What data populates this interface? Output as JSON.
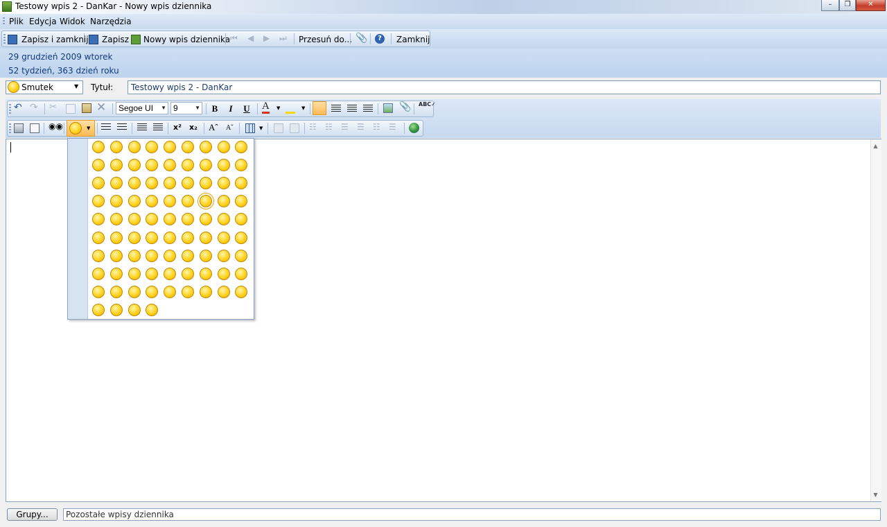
{
  "window": {
    "title": "Testowy wpis 2 - DanKar - Nowy wpis dziennika"
  },
  "menu": {
    "items": [
      "Plik",
      "Edycja",
      "Widok",
      "Narzędzia"
    ]
  },
  "toolbar": {
    "save_close": "Zapisz i zamknij",
    "save": "Zapisz",
    "new_entry": "Nowy wpis dziennika",
    "move_to": "Przesuń do...",
    "close": "Zamknij"
  },
  "header": {
    "date": "29 grudzień 2009 wtorek",
    "week_day": "52 tydzień,  363 dzień roku"
  },
  "entry": {
    "mood": "Smutek",
    "title_label": "Tytuł:",
    "title_value": "Testowy wpis 2 - DanKar"
  },
  "format": {
    "font": "Segoe UI",
    "size": "9",
    "bold": "B",
    "italic": "I",
    "underline": "U"
  },
  "status": {
    "groups_button": "Grupy...",
    "remaining": "Pozostałe wpisy dziennika"
  },
  "emoticons": {
    "rows": [
      9,
      9,
      9,
      9,
      9,
      9,
      9,
      9,
      9,
      4
    ],
    "selected_row": 3,
    "selected_col": 6
  }
}
